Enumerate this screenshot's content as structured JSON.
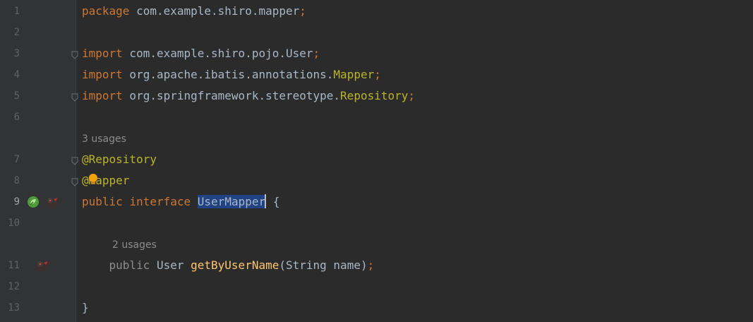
{
  "editor": {
    "lines": [
      {
        "kind": "code",
        "number": "1",
        "segments": [
          [
            "kw",
            "package"
          ],
          [
            "plain",
            " com.example.shiro.mapper"
          ],
          [
            "kw",
            ";"
          ]
        ]
      },
      {
        "kind": "code",
        "number": "2",
        "segments": []
      },
      {
        "kind": "code",
        "number": "3",
        "fold": true,
        "segments": [
          [
            "kw",
            "import"
          ],
          [
            "plain",
            " com.example.shiro.pojo.User"
          ],
          [
            "kw",
            ";"
          ]
        ]
      },
      {
        "kind": "code",
        "number": "4",
        "segments": [
          [
            "kw",
            "import"
          ],
          [
            "plain",
            " org.apache.ibatis.annotations."
          ],
          [
            "ann",
            "Mapper"
          ],
          [
            "kw",
            ";"
          ]
        ]
      },
      {
        "kind": "code",
        "number": "5",
        "fold": true,
        "segments": [
          [
            "kw",
            "import"
          ],
          [
            "plain",
            " org.springframework.stereotype."
          ],
          [
            "ann",
            "Repository"
          ],
          [
            "kw",
            ";"
          ]
        ]
      },
      {
        "kind": "code",
        "number": "6",
        "segments": []
      },
      {
        "kind": "inlay",
        "text": "3 usages"
      },
      {
        "kind": "code",
        "number": "7",
        "fold": true,
        "segments": [
          [
            "ann",
            "@Repository"
          ]
        ]
      },
      {
        "kind": "code",
        "number": "8",
        "fold": true,
        "bulb": true,
        "segments": [
          [
            "ann",
            "@Mapper"
          ]
        ]
      },
      {
        "kind": "code",
        "number": "9",
        "current": true,
        "icons": [
          "spring-bean-icon",
          "mybatis-mapper-icon"
        ],
        "segments": [
          [
            "kw",
            "public"
          ],
          [
            "plain",
            " "
          ],
          [
            "kw",
            "interface"
          ],
          [
            "plain",
            " "
          ],
          [
            "sel",
            "UserMapper"
          ],
          [
            "caret",
            ""
          ],
          [
            "plain",
            " {"
          ]
        ]
      },
      {
        "kind": "code",
        "number": "10",
        "segments": []
      },
      {
        "kind": "inlay",
        "text": "2 usages",
        "indent": true
      },
      {
        "kind": "code",
        "number": "11",
        "icons": [
          "mybatis-method-icon"
        ],
        "segments": [
          [
            "plain",
            "    "
          ],
          [
            "muted",
            "public"
          ],
          [
            "plain",
            " User "
          ],
          [
            "fn",
            "getByUserName"
          ],
          [
            "plain",
            "(String name)"
          ],
          [
            "kw",
            ";"
          ]
        ]
      },
      {
        "kind": "code",
        "number": "12",
        "segments": []
      },
      {
        "kind": "code",
        "number": "13",
        "segments": [
          [
            "plain",
            "}"
          ]
        ]
      }
    ]
  },
  "colors": {
    "background": "#2b2b2b",
    "gutter": "#313335",
    "keyword": "#cc7832",
    "annotation": "#bbb529",
    "method": "#ffc66d",
    "text": "#a9b7c6",
    "selection": "#214283"
  }
}
